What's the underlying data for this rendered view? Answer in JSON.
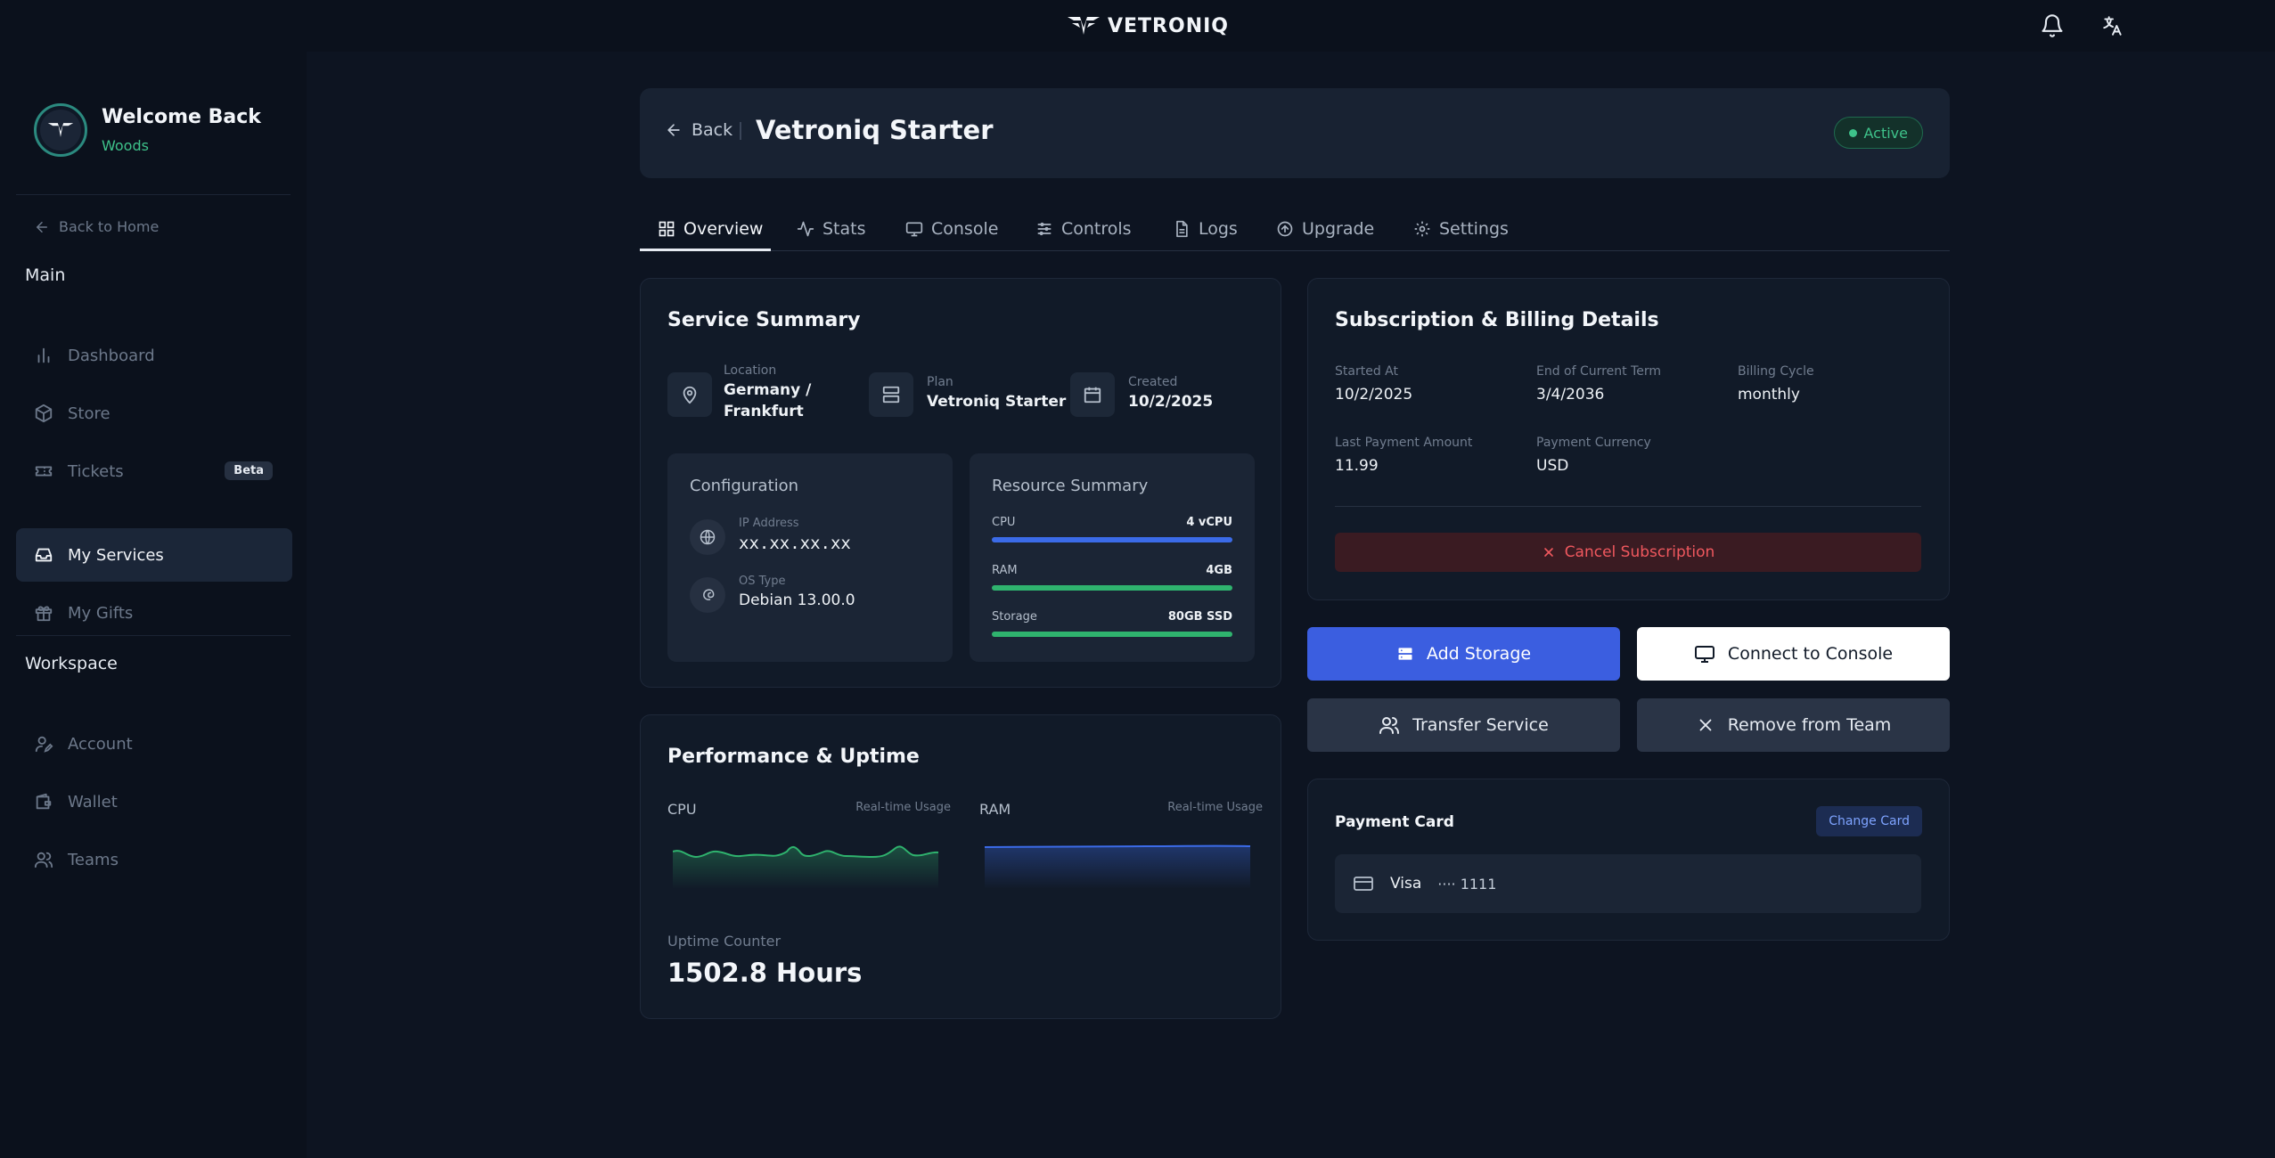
{
  "brand": {
    "name": "VETRONIQ"
  },
  "topbar": {
    "icons": [
      "bell-icon",
      "translate-icon"
    ]
  },
  "sidebar": {
    "welcome": "Welcome Back",
    "username": "Woods",
    "back_home": "Back to Home",
    "main_label": "Main",
    "main_items": [
      {
        "label": "Dashboard",
        "icon": "chart-icon"
      },
      {
        "label": "Store",
        "icon": "box-icon"
      },
      {
        "label": "Tickets",
        "icon": "ticket-icon",
        "badge": "Beta"
      },
      {
        "label": "My Services",
        "icon": "inbox-icon",
        "active": true
      },
      {
        "label": "My Gifts",
        "icon": "gift-icon"
      }
    ],
    "workspace_label": "Workspace",
    "workspace_items": [
      {
        "label": "Account",
        "icon": "user-edit-icon"
      },
      {
        "label": "Wallet",
        "icon": "wallet-icon"
      },
      {
        "label": "Teams",
        "icon": "users-icon"
      }
    ]
  },
  "header": {
    "back_label": "Back",
    "title": "Vetroniq Starter",
    "status": "Active"
  },
  "tabs": [
    {
      "label": "Overview",
      "icon": "grid-icon",
      "active": true
    },
    {
      "label": "Stats",
      "icon": "activity-icon"
    },
    {
      "label": "Console",
      "icon": "monitor-icon"
    },
    {
      "label": "Controls",
      "icon": "sliders-icon"
    },
    {
      "label": "Logs",
      "icon": "file-icon"
    },
    {
      "label": "Upgrade",
      "icon": "arrow-up-circle-icon"
    },
    {
      "label": "Settings",
      "icon": "gear-icon"
    }
  ],
  "service_summary": {
    "title": "Service Summary",
    "location_label": "Location",
    "location_line1": "Germany /",
    "location_line2": "Frankfurt",
    "plan_label": "Plan",
    "plan_value": "Vetroniq Starter",
    "created_label": "Created",
    "created_value": "10/2/2025",
    "configuration": {
      "title": "Configuration",
      "ip_label": "IP Address",
      "ip_value": "xx.xx.xx.xx",
      "os_label": "OS Type",
      "os_value": "Debian 13.00.0"
    },
    "resources": {
      "title": "Resource Summary",
      "items": [
        {
          "label": "CPU",
          "value": "4 vCPU",
          "fill_fraction": 1.0,
          "color": "#3b6be8"
        },
        {
          "label": "RAM",
          "value": "4GB",
          "fill_fraction": 1.0,
          "color": "#2fb36e"
        },
        {
          "label": "Storage",
          "value": "80GB SSD",
          "fill_fraction": 1.0,
          "color": "#2fb36e"
        }
      ]
    }
  },
  "performance": {
    "title": "Performance & Uptime",
    "cpu_label": "CPU",
    "cpu_note": "Real-time Usage",
    "ram_label": "RAM",
    "ram_note": "Real-time Usage",
    "uptime_label": "Uptime Counter",
    "uptime_value": "1502.8 Hours",
    "colors": {
      "cpu": "#2fb36e",
      "ram": "#3b6be8"
    }
  },
  "billing": {
    "title": "Subscription & Billing Details",
    "started_label": "Started At",
    "started_value": "10/2/2025",
    "end_label": "End of Current Term",
    "end_value": "3/4/2036",
    "cycle_label": "Billing Cycle",
    "cycle_value": "monthly",
    "last_payment_label": "Last Payment Amount",
    "last_payment_value": "11.99",
    "currency_label": "Payment Currency",
    "currency_value": "USD",
    "cancel_label": "Cancel Subscription"
  },
  "actions": {
    "add_storage": "Add Storage",
    "connect_console": "Connect to Console",
    "transfer_service": "Transfer Service",
    "remove_team": "Remove from Team"
  },
  "payment_card": {
    "title": "Payment Card",
    "change_label": "Change Card",
    "card_brand": "Visa",
    "card_masked": "···· 1111"
  }
}
